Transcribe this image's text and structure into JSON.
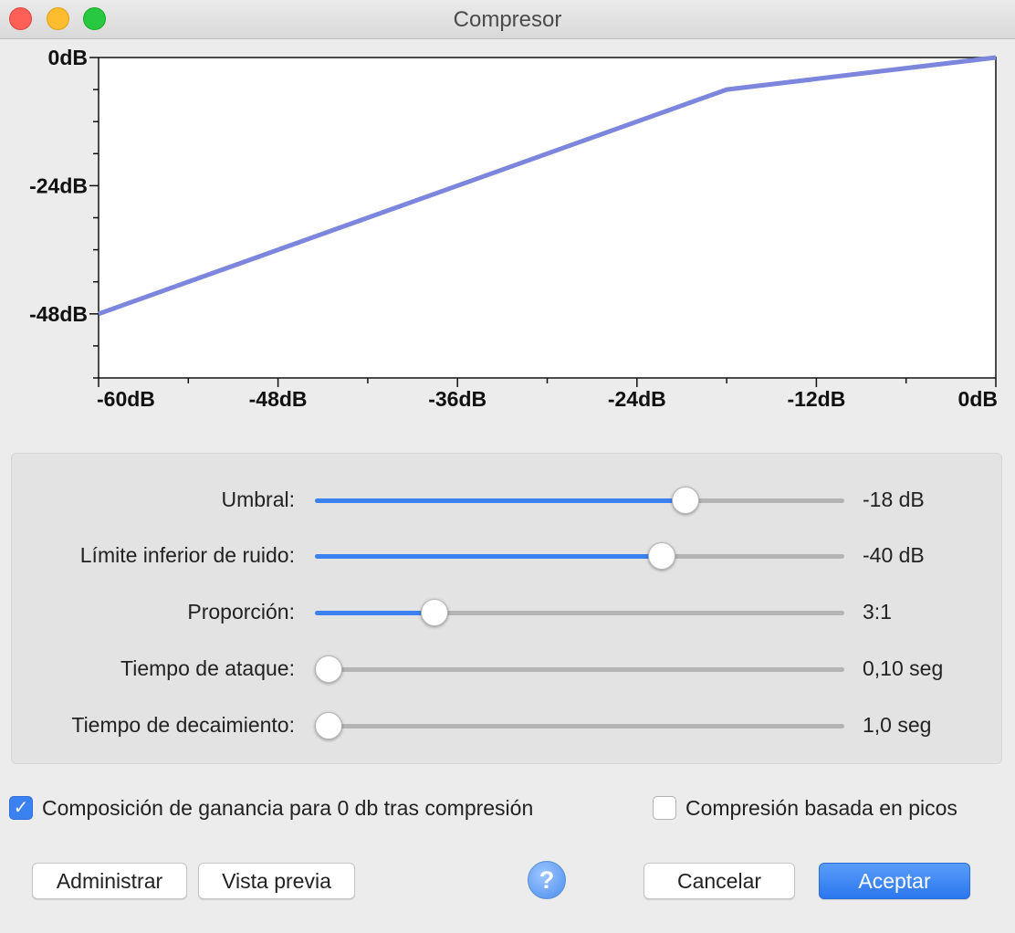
{
  "window": {
    "title": "Compresor"
  },
  "chart_data": {
    "type": "line",
    "xlim": [
      -60,
      0
    ],
    "ylim": [
      -60,
      0
    ],
    "x_ticks": [
      "-60dB",
      "-48dB",
      "-36dB",
      "-24dB",
      "-12dB",
      "0dB"
    ],
    "y_ticks": [
      "0dB",
      "-24dB",
      "-48dB"
    ],
    "x": [
      -60,
      -18,
      0
    ],
    "y": [
      -48,
      -6,
      0
    ],
    "line_color": "#7b86dc"
  },
  "sliders": [
    {
      "label": "Umbral:",
      "value": "-18 dB",
      "position": 0.7,
      "filled": true
    },
    {
      "label": "Límite inferior de ruido:",
      "value": "-40 dB",
      "position": 0.655,
      "filled": true
    },
    {
      "label": "Proporción:",
      "value": "3:1",
      "position": 0.225,
      "filled": true
    },
    {
      "label": "Tiempo de ataque:",
      "value": "0,10 seg",
      "position": 0.025,
      "filled": false
    },
    {
      "label": "Tiempo de decaimiento:",
      "value": "1,0 seg",
      "position": 0.025,
      "filled": false
    }
  ],
  "checkboxes": {
    "makeup": {
      "label": "Composición de ganancia para 0 db tras compresión",
      "checked": true
    },
    "peaks": {
      "label": "Compresión basada en picos",
      "checked": false
    }
  },
  "buttons": {
    "manage": "Administrar",
    "preview": "Vista previa",
    "help": "?",
    "cancel": "Cancelar",
    "ok": "Aceptar"
  },
  "colors": {
    "accent": "#3b82f0",
    "curve": "#7b86dc"
  }
}
